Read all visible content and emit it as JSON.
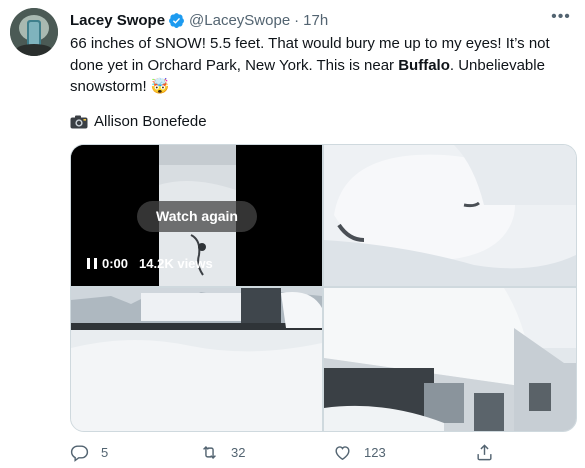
{
  "author": {
    "name": "Lacey Swope",
    "handle": "@LaceySwope",
    "separator": "·",
    "time": "17h"
  },
  "tweet": {
    "text_part1": "66 inches of SNOW! 5.5 feet. That would bury me up to my eyes! It’s not done yet in Orchard Park, New York. This is near ",
    "text_bold": "Buffalo",
    "text_part2": ". Unbelievable snowstorm! 🤯",
    "credit_name": "Allison Bonefede"
  },
  "video": {
    "watch_again_label": "Watch again",
    "time": "0:00",
    "views": "14.2K views"
  },
  "actions": {
    "reply_count": "5",
    "retweet_count": "32",
    "like_count": "123"
  },
  "icons": {
    "avatar": "avatar-image",
    "verified": "verified-badge-icon",
    "more": "more-options-icon",
    "camera": "camera-icon",
    "pause": "pause-icon",
    "reply": "reply-icon",
    "retweet": "retweet-icon",
    "like": "heart-icon",
    "share": "share-icon"
  },
  "colors": {
    "text": "#0f1419",
    "secondary": "#536471",
    "verified": "#1d9bf0",
    "border": "#cfd9de"
  }
}
